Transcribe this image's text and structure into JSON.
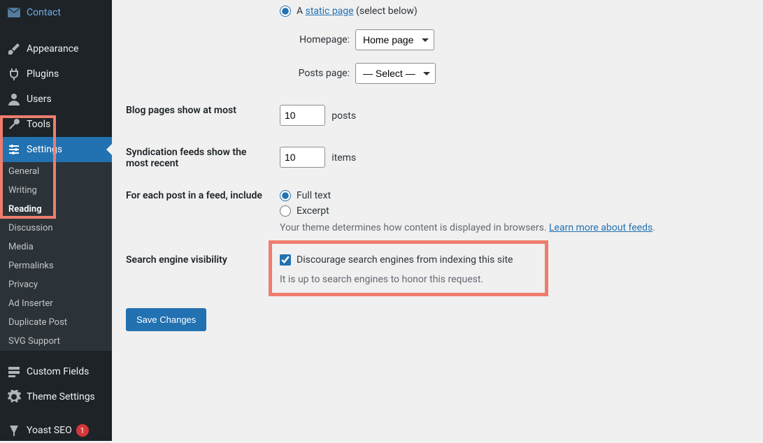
{
  "sidebar": {
    "top": [
      {
        "label": "Contact",
        "icon": "mail"
      },
      {
        "label": "Appearance",
        "icon": "brush"
      },
      {
        "label": "Plugins",
        "icon": "plug"
      },
      {
        "label": "Users",
        "icon": "user"
      },
      {
        "label": "Tools",
        "icon": "wrench"
      }
    ],
    "settings_label": "Settings",
    "submenu": [
      {
        "label": "General"
      },
      {
        "label": "Writing"
      },
      {
        "label": "Reading",
        "current": true
      },
      {
        "label": "Discussion"
      },
      {
        "label": "Media"
      },
      {
        "label": "Permalinks"
      },
      {
        "label": "Privacy"
      },
      {
        "label": "Ad Inserter"
      },
      {
        "label": "Duplicate Post"
      },
      {
        "label": "SVG Support"
      }
    ],
    "bottom": [
      {
        "label": "Custom Fields",
        "icon": "fields"
      },
      {
        "label": "Theme Settings",
        "icon": "gear"
      },
      {
        "label": "Yoast SEO",
        "icon": "yoast",
        "badge": "1"
      }
    ]
  },
  "radio_static": {
    "prefix": "A ",
    "link": "static page",
    "suffix": " (select below)"
  },
  "homepage": {
    "label": "Homepage:",
    "selected": "Home page"
  },
  "posts_page": {
    "label": "Posts page:",
    "selected": "— Select —"
  },
  "blog_pages": {
    "label": "Blog pages show at most",
    "value": "10",
    "unit": "posts"
  },
  "syndication": {
    "label": "Syndication feeds show the most recent",
    "value": "10",
    "unit": "items"
  },
  "feed_include": {
    "label": "For each post in a feed, include",
    "full_text": "Full text",
    "excerpt": "Excerpt",
    "desc_prefix": "Your theme determines how content is displayed in browsers. ",
    "desc_link": "Learn more about feeds",
    "desc_suffix": "."
  },
  "search_visibility": {
    "label": "Search engine visibility",
    "checkbox_label": "Discourage search engines from indexing this site",
    "note": "It is up to search engines to honor this request."
  },
  "save_button": "Save Changes"
}
